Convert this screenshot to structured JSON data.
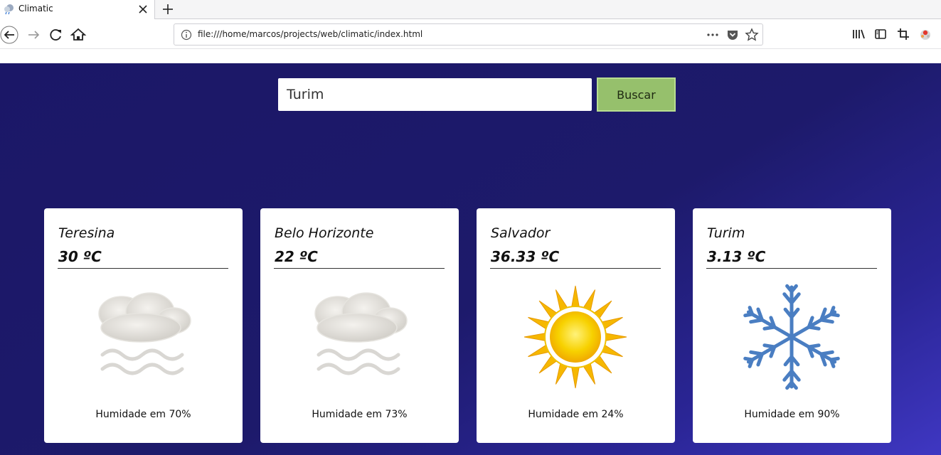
{
  "browser": {
    "tab_title": "Climatic",
    "url": "file:///home/marcos/projects/web/climatic/index.html"
  },
  "search": {
    "value": "Turim",
    "button_label": "Buscar"
  },
  "cards": [
    {
      "city": "Teresina",
      "temp": "30 ºC",
      "condition": "fog-icon",
      "humidity": "Humidade em 70%"
    },
    {
      "city": "Belo Horizonte",
      "temp": "22 ºC",
      "condition": "fog-icon",
      "humidity": "Humidade em 73%"
    },
    {
      "city": "Salvador",
      "temp": "36.33 ºC",
      "condition": "sun-icon",
      "humidity": "Humidade em 24%"
    },
    {
      "city": "Turim",
      "temp": "3.13 ºC",
      "condition": "snowflake-icon",
      "humidity": "Humidade em 90%"
    }
  ],
  "colors": {
    "page_background": "#1d1a6b",
    "button_background": "#96c06c",
    "snow_blue": "#4a7ec2",
    "sun_yellow": "#f6c400"
  }
}
